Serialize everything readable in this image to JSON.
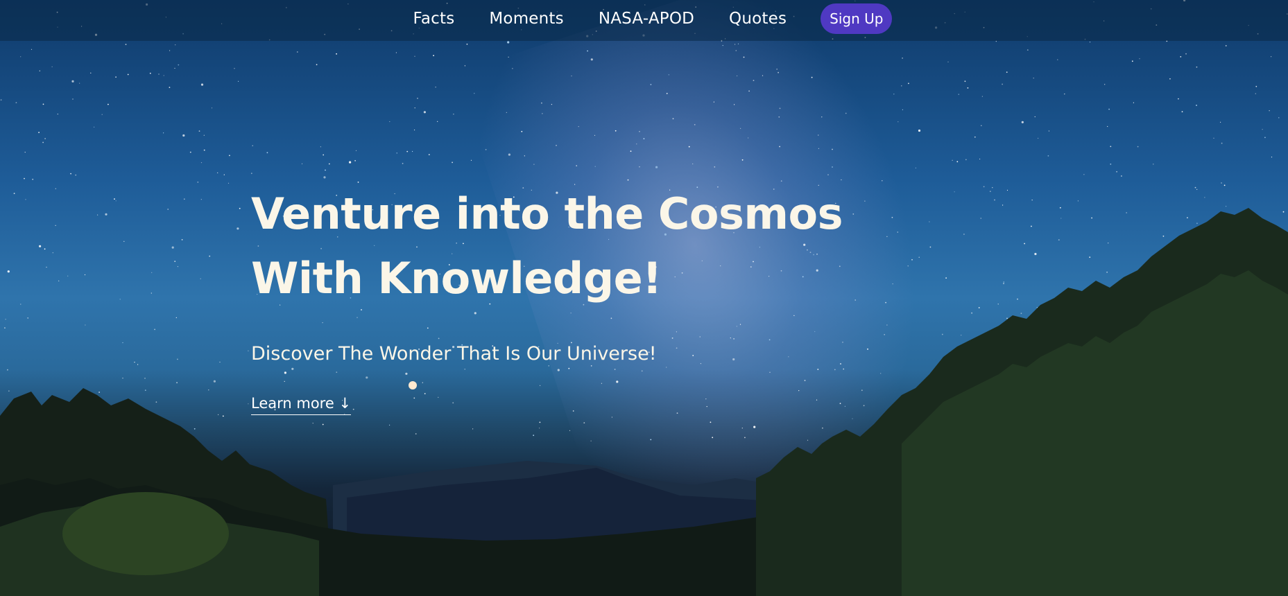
{
  "nav": {
    "links": [
      {
        "label": "Facts"
      },
      {
        "label": "Moments"
      },
      {
        "label": "NASA-APOD"
      },
      {
        "label": "Quotes"
      }
    ],
    "signup_label": "Sign Up"
  },
  "hero": {
    "headline_line1": "Venture into the Cosmos",
    "headline_line2": "With Knowledge!",
    "subheadline": "Discover The Wonder That Is Our Universe!",
    "cta_label": "Learn more ↓"
  },
  "colors": {
    "signup_button": "#4f39c2",
    "headline_text": "#fbf6e8"
  }
}
